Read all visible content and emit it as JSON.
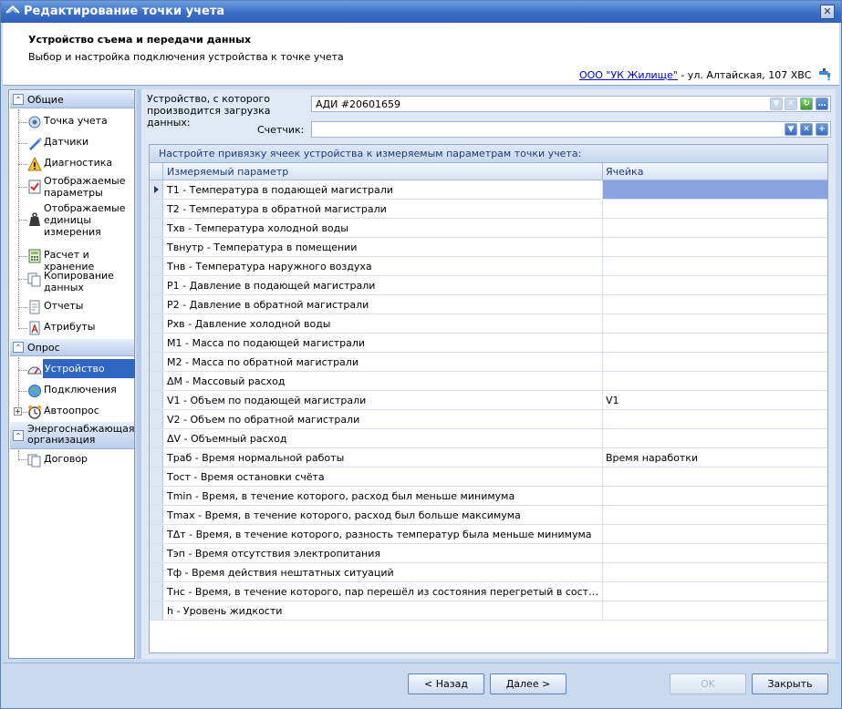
{
  "window": {
    "title": "Редактирование точки учета",
    "close_glyph": "✕"
  },
  "header": {
    "title": "Устройство съема и передачи данных",
    "subtitle": "Выбор и настройка подключения устройства к точке учета",
    "org_link": "ООО \"УК Жилище\"",
    "org_suffix": " - ул. Алтайская, 107 ХВС",
    "faucet_icon": "water-faucet-icon"
  },
  "nav": {
    "groups": [
      {
        "label": "Общие",
        "items": [
          {
            "label": "Точка учета",
            "icon": "meter-point-icon"
          },
          {
            "label": "Датчики",
            "icon": "sensor-pen-icon"
          },
          {
            "label": "Диагностика",
            "icon": "warning-icon"
          },
          {
            "label": "Отображаемые параметры",
            "icon": "checklist-icon"
          },
          {
            "label": "Отображаемые единицы измерения",
            "icon": "weight-icon"
          },
          {
            "label": "Расчет и хранение",
            "icon": "calculator-icon"
          },
          {
            "label": "Копирование данных",
            "icon": "copy-icon"
          },
          {
            "label": "Отчеты",
            "icon": "report-icon"
          },
          {
            "label": "Атрибуты",
            "icon": "attribute-icon"
          }
        ]
      },
      {
        "label": "Опрос",
        "items": [
          {
            "label": "Устройство",
            "icon": "device-gauge-icon"
          },
          {
            "label": "Подключения",
            "icon": "connection-globe-icon"
          },
          {
            "label": "Автоопрос",
            "icon": "alarm-clock-icon"
          }
        ]
      },
      {
        "label": "Энергоснабжающая организация",
        "items": [
          {
            "label": "Договор",
            "icon": "contract-icon"
          }
        ]
      }
    ],
    "collapse_glyph": "⌃",
    "expand_glyph": "+"
  },
  "form": {
    "device_label": "Устройство, с которого производится загрузка данных:",
    "device_value": "АДИ #20601659",
    "counter_label": "Счетчик:",
    "counter_value": ""
  },
  "grid": {
    "caption": "Настройте привязку ячеек устройства к измеряемым параметрам точки учета:",
    "col_param": "Измеряемый параметр",
    "col_cell": "Ячейка",
    "rows": [
      {
        "param": "T1 - Температура в подающей магистрали",
        "cell": ""
      },
      {
        "param": "T2 - Температура в обратной магистрали",
        "cell": ""
      },
      {
        "param": "Txв - Температура холодной воды",
        "cell": ""
      },
      {
        "param": "Tвнутр - Температура в помещении",
        "cell": ""
      },
      {
        "param": "Tнв - Температура наружного воздуха",
        "cell": ""
      },
      {
        "param": "P1 - Давление в подающей магистрали",
        "cell": ""
      },
      {
        "param": "P2 - Давление в обратной магистрали",
        "cell": ""
      },
      {
        "param": "Pxв - Давление холодной воды",
        "cell": ""
      },
      {
        "param": "M1 - Масса по подающей магистрали",
        "cell": ""
      },
      {
        "param": "M2 - Масса по обратной магистрали",
        "cell": ""
      },
      {
        "param": "ΔM - Массовый расход",
        "cell": ""
      },
      {
        "param": "V1 - Объем по подающей магистрали",
        "cell": "V1"
      },
      {
        "param": "V2 - Объем по обратной магистрали",
        "cell": ""
      },
      {
        "param": "ΔV - Объемный расход",
        "cell": ""
      },
      {
        "param": "Tраб - Время нормальной работы",
        "cell": "Время наработки"
      },
      {
        "param": "Tост - Время остановки счёта",
        "cell": ""
      },
      {
        "param": "Tmin - Время, в течение которого, расход был меньше минимума",
        "cell": ""
      },
      {
        "param": "Tmax - Время, в течение которого, расход был больше максимума",
        "cell": ""
      },
      {
        "param": "TΔт - Время, в течение которого, разность температур была меньше минимума",
        "cell": ""
      },
      {
        "param": "Tэп - Время отсутствия электропитания",
        "cell": ""
      },
      {
        "param": "Tф - Время действия нештатных ситуаций",
        "cell": ""
      },
      {
        "param": "Tнс - Время, в течение которого, пар перешёл из состояния перегретый в состояние насыщенный",
        "cell": ""
      },
      {
        "param": "h - Уровень жидкости",
        "cell": ""
      }
    ]
  },
  "footer": {
    "back": "< Назад",
    "next": "Далее >",
    "ok": "OK",
    "close": "Закрыть"
  }
}
